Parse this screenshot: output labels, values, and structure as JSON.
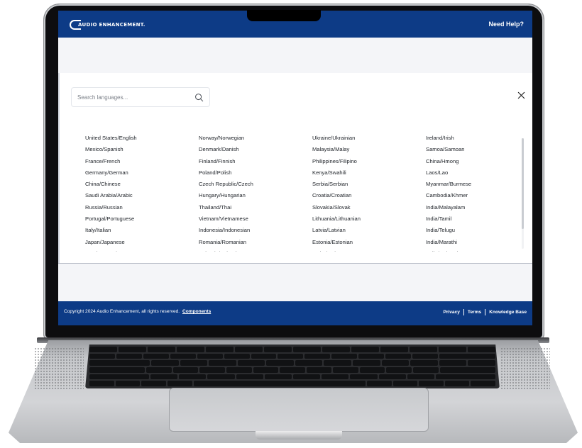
{
  "header": {
    "brand": "AUDIO ENHANCEMENT.",
    "help_link": "Need Help?"
  },
  "search": {
    "placeholder": "Search languages..."
  },
  "languages": {
    "columns": [
      [
        "United States/English",
        "Mexico/Spanish",
        "France/French",
        "Germany/German",
        "China/Chinese",
        "Saudi Arabia/Arabic",
        "Russia/Russian",
        "Portugal/Portuguese",
        "Italy/Italian",
        "Japan/Japanese",
        "South Korea/Korean"
      ],
      [
        "Norway/Norwegian",
        "Denmark/Danish",
        "Finland/Finnish",
        "Poland/Polish",
        "Czech Republic/Czech",
        "Hungary/Hungarian",
        "Thailand/Thai",
        "Vietnam/Vietnamese",
        "Indonesia/Indonesian",
        "Romania/Romanian",
        "Bulgaria/Bulgarian"
      ],
      [
        "Ukraine/Ukrainian",
        "Malaysia/Malay",
        "Philippines/Filipino",
        "Kenya/Swahili",
        "Serbia/Serbian",
        "Croatia/Croatian",
        "Slovakia/Slovak",
        "Lithuania/Lithuanian",
        "Latvia/Latvian",
        "Estonia/Estonian",
        "Malta/Maltese"
      ],
      [
        "Ireland/Irish",
        "Samoa/Samoan",
        "China/Hmong",
        "Laos/Lao",
        "Myanmar/Burmese",
        "Cambodia/Khmer",
        "India/Malayalam",
        "India/Tamil",
        "India/Telugu",
        "India/Marathi",
        "India/Gujarati"
      ]
    ]
  },
  "footer": {
    "copyright": "Copyright 2024 Audio Enhancement, all rights reserved.",
    "components_link": "Components",
    "links": [
      "Privacy",
      "Terms",
      "Knowledge Base"
    ]
  },
  "colors": {
    "brand_blue": "#0d3b86",
    "page_bg": "#f4f5f8",
    "text": "#1f2329"
  },
  "icons": {
    "search": "search-icon",
    "close": "close-icon"
  }
}
